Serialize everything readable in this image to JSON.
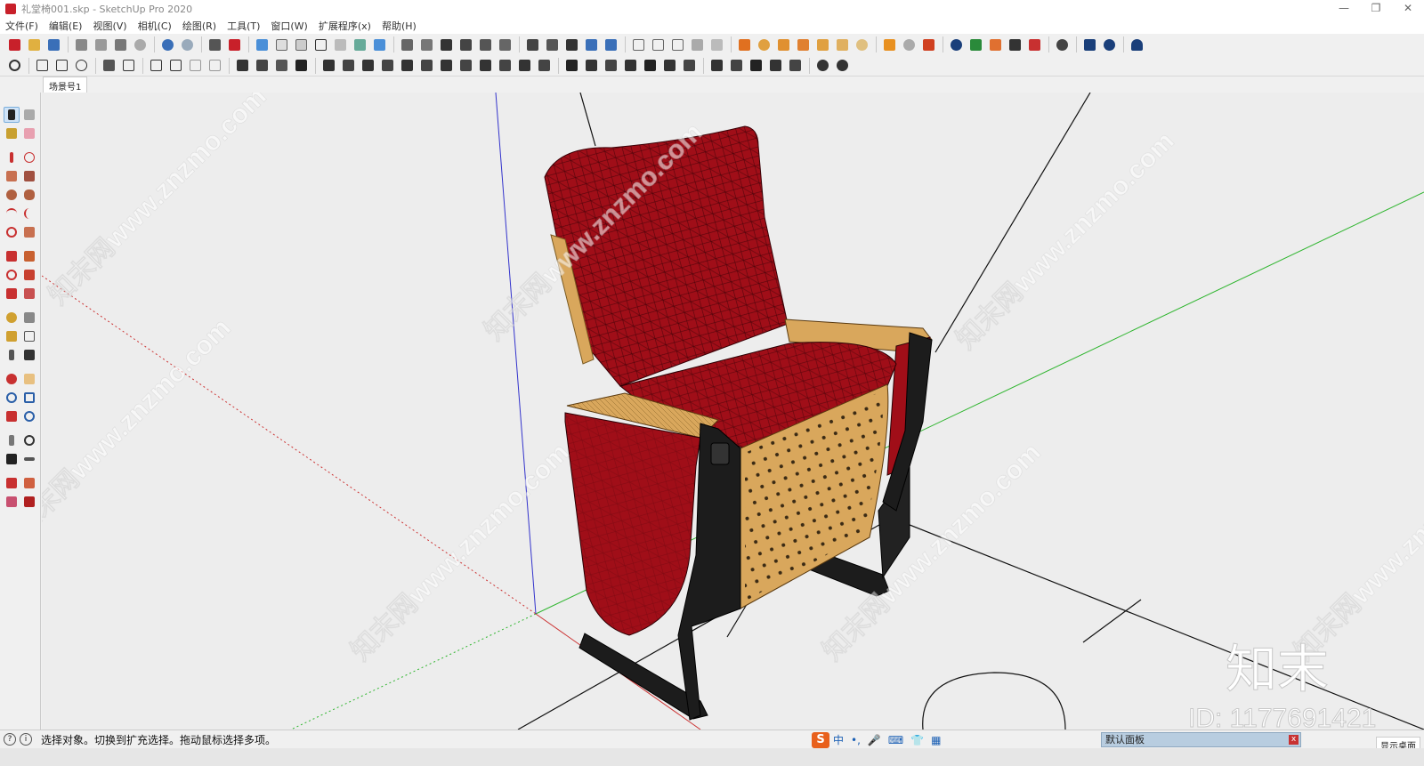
{
  "window": {
    "title": "礼堂椅001.skp - SketchUp Pro 2020",
    "controls": [
      "—",
      "❐",
      "✕"
    ]
  },
  "menu": [
    "文件(F)",
    "编辑(E)",
    "视图(V)",
    "相机(C)",
    "绘图(R)",
    "工具(T)",
    "窗口(W)",
    "扩展程序(x)",
    "帮助(H)"
  ],
  "scene_tab": "场景号1",
  "status": {
    "hint": "选择对象。切换到扩充选择。拖动鼠标选择多项。"
  },
  "ime": {
    "logo": "S",
    "lang": "中",
    "punct": "•,"
  },
  "tray": {
    "panel_title": "默认面板",
    "close": "x",
    "show_desktop": "显示桌面"
  },
  "watermark": {
    "brand": "知末",
    "id_text": "ID: 1177691421",
    "site": "知末网www.znzmo.com"
  },
  "colors": {
    "seat_red": "#a00e18",
    "wood": "#d9a75c",
    "frame": "#1c1c1c",
    "axis_green": "#2eb52e",
    "axis_blue": "#3333cc",
    "axis_red": "#cc3333"
  }
}
